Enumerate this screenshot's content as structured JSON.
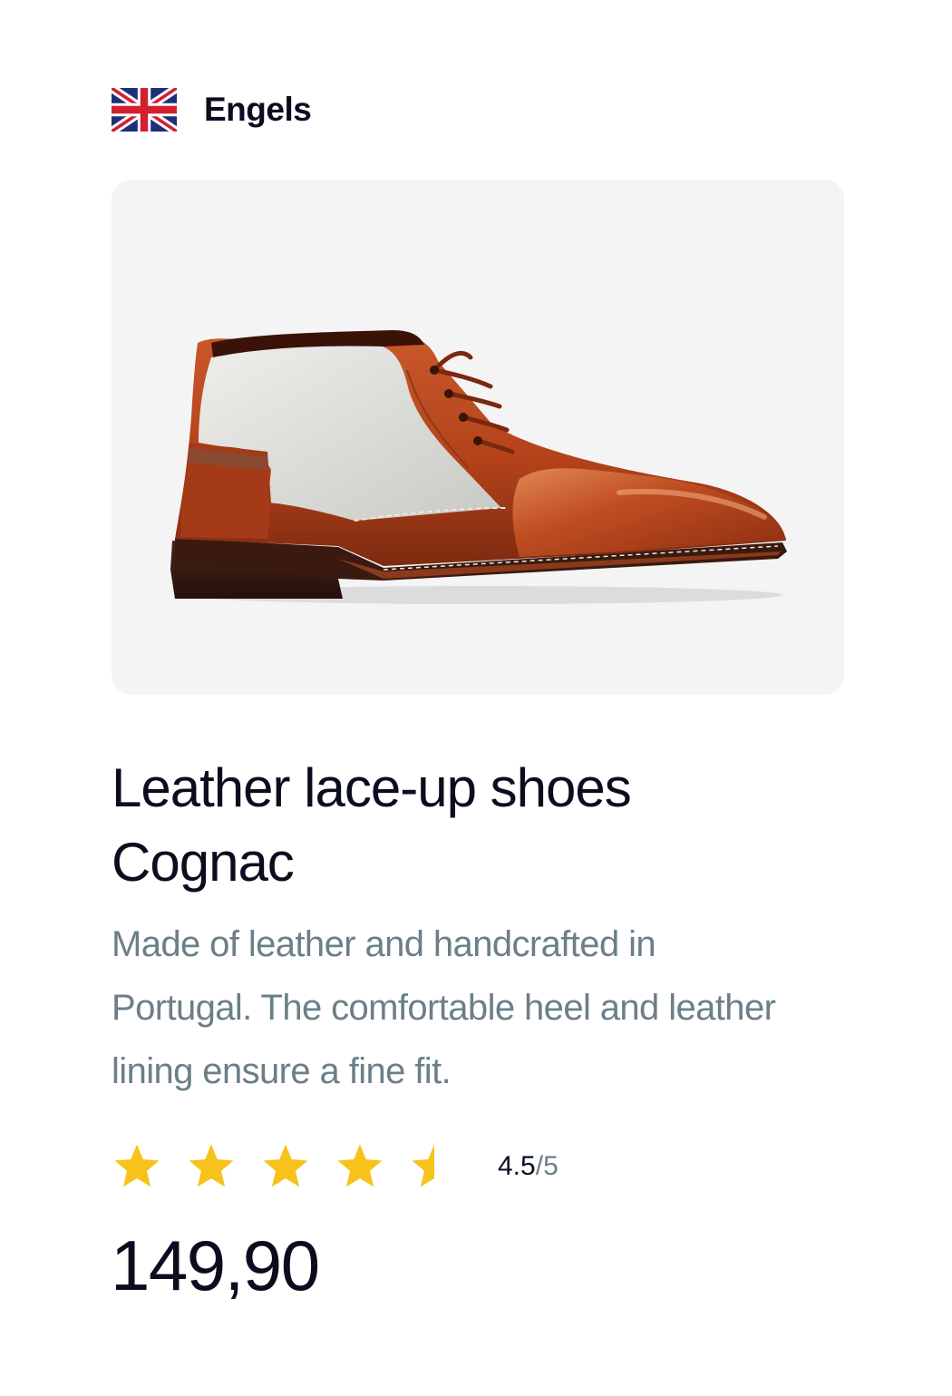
{
  "language": {
    "flag_icon": "uk-flag-icon",
    "label": "Engels"
  },
  "product": {
    "image_alt": "Leather lace-up shoe",
    "title_line1": "Leather lace-up shoes",
    "title_line2": "Cognac",
    "description_line1": "Made of leather and handcrafted in",
    "description_line2": "Portugal. The comfortable heel and leather",
    "description_line3": "lining ensure a fine fit.",
    "rating": {
      "value": "4.5",
      "separator": "/",
      "max": "5",
      "stars": 4.5,
      "star_color": "#f7c21c"
    },
    "price": "149,90"
  },
  "colors": {
    "text": "#0b0d1f",
    "muted": "#6b7f87",
    "card_bg": "#f4f4f4",
    "leather": "#b8461f"
  }
}
